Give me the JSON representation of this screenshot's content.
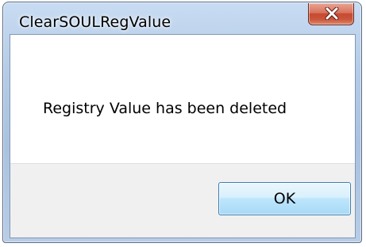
{
  "window": {
    "title": "ClearSOULRegValue",
    "close_icon": "close-icon"
  },
  "dialog": {
    "message": "Registry Value has been deleted",
    "ok_label": "OK"
  },
  "colors": {
    "close_button": "#c64a31",
    "ok_button_border": "#3c7fb1",
    "button_area_bg": "#f0f0f0"
  }
}
